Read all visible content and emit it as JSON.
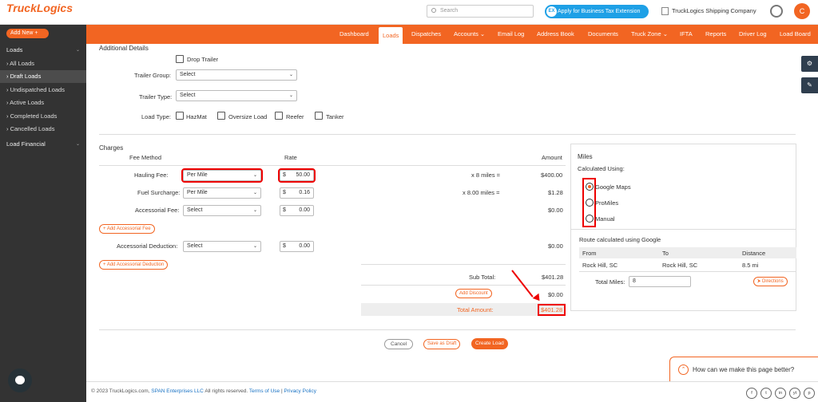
{
  "brand": {
    "logo_text": "TruckLogics",
    "accent": "#f26522",
    "sidebar_bg": "#333333"
  },
  "topbar": {
    "search_placeholder": "Search",
    "tax_button": "Apply for Business Tax Extension",
    "company": "TruckLogics Shipping Company",
    "avatar_initial": "C"
  },
  "sidebar": {
    "add_new": "Add New +",
    "loads_section": "Loads",
    "items": [
      {
        "label": "› All Loads"
      },
      {
        "label": "› Draft Loads"
      },
      {
        "label": "› Undispatched Loads"
      },
      {
        "label": "› Active Loads"
      },
      {
        "label": "› Completed Loads"
      },
      {
        "label": "› Cancelled Loads"
      }
    ],
    "financial_section": "Load Financial"
  },
  "nav": {
    "items": [
      {
        "label": "Dashboard"
      },
      {
        "label": "Loads"
      },
      {
        "label": "Dispatches"
      },
      {
        "label": "Accounts ⌄"
      },
      {
        "label": "Email Log"
      },
      {
        "label": "Address Book"
      },
      {
        "label": "Documents"
      },
      {
        "label": "Truck Zone ⌄"
      },
      {
        "label": "IFTA"
      },
      {
        "label": "Reports"
      },
      {
        "label": "Driver Log"
      },
      {
        "label": "Load Board"
      }
    ]
  },
  "additional": {
    "title": "Additional Details",
    "drop_trailer": "Drop Trailer",
    "trailer_group_label": "Trailer Group:",
    "trailer_group_value": "Select",
    "trailer_type_label": "Trailer Type:",
    "trailer_type_value": "Select",
    "load_type_label": "Load Type:",
    "load_types": [
      "HazMat",
      "Oversize Load",
      "Reefer",
      "Tanker"
    ]
  },
  "charges": {
    "title": "Charges",
    "col_fee_method": "Fee Method",
    "col_rate": "Rate",
    "col_amount": "Amount",
    "hauling_label": "Hauling Fee:",
    "hauling_method": "Per Mile",
    "hauling_currency": "$",
    "hauling_rate": "50.00",
    "hauling_calc": "x 8 miles =",
    "hauling_amount": "$400.00",
    "fuel_label": "Fuel Surcharge:",
    "fuel_method": "Per Mile",
    "fuel_currency": "$",
    "fuel_rate": "0.16",
    "fuel_calc": "x 8.00 miles =",
    "fuel_amount": "$1.28",
    "acc_label": "Accessorial Fee:",
    "acc_method": "Select",
    "acc_currency": "$",
    "acc_rate": "0.00",
    "acc_amount": "$0.00",
    "add_acc_fee": "+ Add Accessorial Fee",
    "ded_label": "Accessorial Deduction:",
    "ded_method": "Select",
    "ded_currency": "$",
    "ded_rate": "0.00",
    "ded_amount": "$0.00",
    "add_acc_ded": "+ Add Accessorial Deduction",
    "subtotal_label": "Sub Total:",
    "subtotal_value": "$401.28",
    "add_discount": "Add Discount",
    "discount_value": "$0.00",
    "total_label": "Total Amount:",
    "total_value": "$401.28"
  },
  "miles": {
    "title": "Miles",
    "calc_using": "Calculated Using:",
    "options": [
      "Google Maps",
      "ProMiles",
      "Manual"
    ],
    "route_note": "Route calculated using Google",
    "col_from": "From",
    "col_to": "To",
    "col_distance": "Distance",
    "from": "Rock Hill, SC",
    "to": "Rock Hill, SC",
    "distance": "8.5 mi",
    "total_miles_label": "Total Miles:",
    "total_miles_value": "8",
    "directions": "Directions"
  },
  "actions": {
    "cancel": "Cancel",
    "save_draft": "Save as Draft",
    "create": "Create Load"
  },
  "footer": {
    "copyright": "© 2023 TruckLogics.com,",
    "company_link": "SPAN Enterprises LLC",
    "rights": "All rights reserved.",
    "terms": "Terms of Use",
    "sep": "|",
    "privacy": "Privacy Policy",
    "social": [
      "f",
      "t",
      "in",
      "yt",
      "p"
    ]
  },
  "feedback": "How can we make this page better?"
}
